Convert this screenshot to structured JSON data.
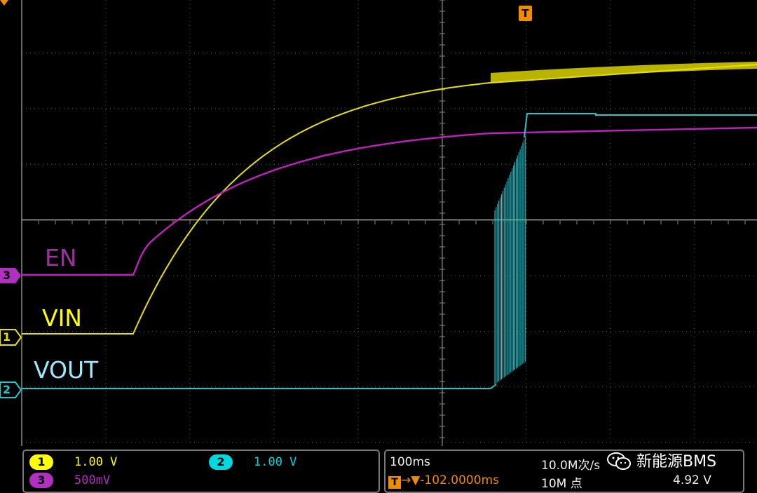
{
  "traces": {
    "en_label": "EN",
    "vin_label": "VIN",
    "vout_label": "VOUT"
  },
  "markers": {
    "ch1": "1",
    "ch2": "2",
    "ch3": "3",
    "trigger": "T"
  },
  "channels": {
    "ch1": {
      "id": "1",
      "scale": "1.00 V",
      "color": "#ffff00"
    },
    "ch2": {
      "id": "2",
      "scale": "1.00 V",
      "color": "#00d8e0"
    },
    "ch3": {
      "id": "3",
      "scale": "500mV",
      "color": "#b030c0"
    }
  },
  "timing": {
    "timebase": "100ms",
    "trigger_offset": "→▼-102.0000ms",
    "sample_rate": "10.0M次/s",
    "record_length": "10M 点",
    "trigger_level": "4.92 V"
  },
  "watermark": {
    "text": "新能源BMS",
    "icon": "wechat-icon"
  },
  "colors": {
    "en": "#c020c0",
    "vin": "#e8e000",
    "vout": "#20c8d0",
    "trigger": "#f08c00",
    "grid": "#5a5a5a"
  }
}
